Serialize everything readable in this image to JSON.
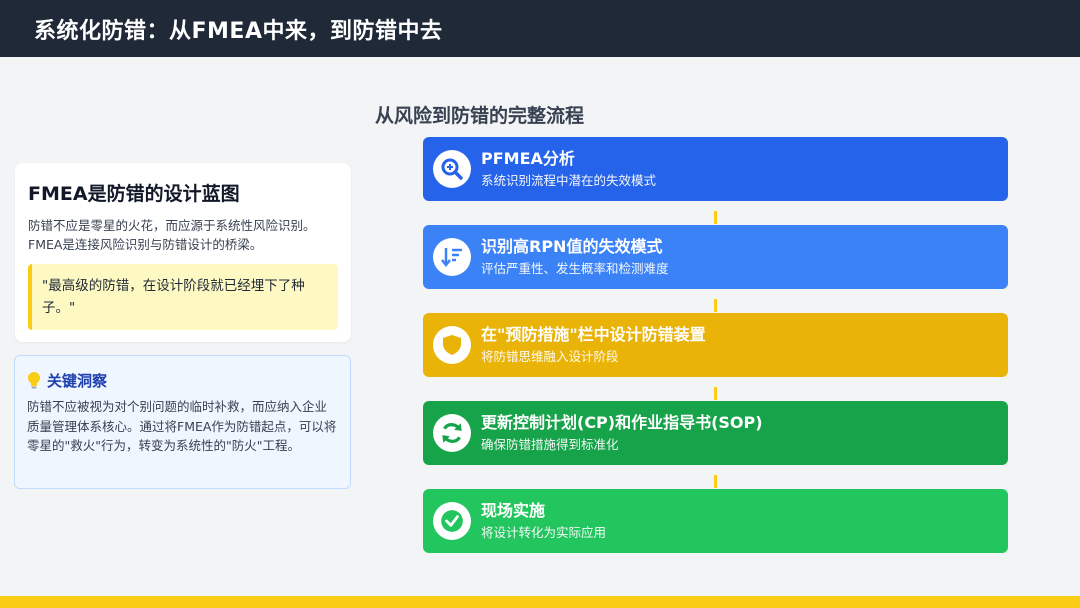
{
  "header": {
    "title": "系统化防错：从FMEA中来，到防错中去"
  },
  "left": {
    "card": {
      "title": "FMEA是防错的设计蓝图",
      "body": "防错不应是零星的火花，而应源于系统性风险识别。FMEA是连接风险识别与防错设计的桥梁。",
      "quote": "\"最高级的防错，在设计阶段就已经埋下了种子。\""
    },
    "insight": {
      "icon": "lightbulb-icon",
      "title": "关键洞察",
      "body": "防错不应被视为对个别问题的临时补救，而应纳入企业质量管理体系核心。通过将FMEA作为防错起点，可以将零星的\"救火\"行为，转变为系统性的\"防火\"工程。"
    }
  },
  "flow": {
    "title": "从风险到防错的完整流程",
    "steps": [
      {
        "title": "PFMEA分析",
        "desc": "系统识别流程中潜在的失效模式",
        "color": "#2563eb",
        "icon": "search-icon"
      },
      {
        "title": "识别高RPN值的失效模式",
        "desc": "评估严重性、发生概率和检测难度",
        "color": "#3b82f6",
        "icon": "sort-down-icon"
      },
      {
        "title": "在\"预防措施\"栏中设计防错装置",
        "desc": "将防错思维融入设计阶段",
        "color": "#eab308",
        "icon": "shield-icon"
      },
      {
        "title": "更新控制计划(CP)和作业指导书(SOP)",
        "desc": "确保防错措施得到标准化",
        "color": "#16a34a",
        "icon": "sync-icon"
      },
      {
        "title": "现场实施",
        "desc": "将设计转化为实际应用",
        "color": "#22c55e",
        "icon": "check-circle-icon"
      }
    ]
  },
  "colors": {
    "header_bg": "#1f2937",
    "accent_yellow": "#facc15",
    "insight_title": "#1e40af"
  }
}
